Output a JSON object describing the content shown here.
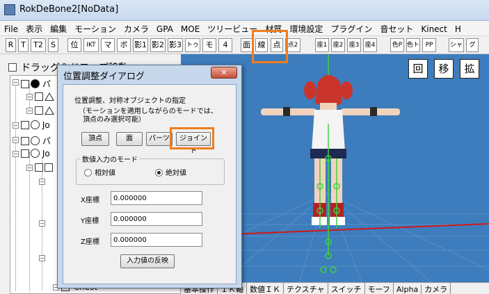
{
  "window": {
    "title": "RokDeBone2[NoData]"
  },
  "menu": [
    "File",
    "表示",
    "編集",
    "モーション",
    "カメラ",
    "GPA",
    "MOE",
    "ツリービュー",
    "材質",
    "環境設定",
    "プラグイン",
    "音セット",
    "Kinect",
    "H"
  ],
  "toolbar": {
    "mode_buttons": [
      "R",
      "T",
      "T2",
      "S",
      "位",
      "IKT",
      "マ",
      "ボ",
      "影1",
      "影2",
      "影3",
      "トゥ",
      "モ",
      "4"
    ],
    "display_buttons": [
      "面",
      "線",
      "点",
      "点2"
    ],
    "coord_buttons": [
      "座1",
      "座2",
      "座3",
      "座4"
    ],
    "color_buttons": [
      "色P",
      "色ト",
      "PP"
    ],
    "extra_buttons": [
      "シャ",
      "グ"
    ]
  },
  "left_panel": {
    "drag_label": "ドラッグ＆ドロップ移動",
    "tree_labels": [
      "パ",
      "パ",
      "Jo",
      "パ",
      "Jo",
      "Chest"
    ]
  },
  "viewport": {
    "buttons": [
      "回",
      "移",
      "拡"
    ]
  },
  "statusbar": [
    "基本操作",
    "ＩＫ軸",
    "数値ＩＫ",
    "テクスチャ",
    "スイッチ",
    "モーフ",
    "Alpha",
    "カメラ"
  ],
  "dialog": {
    "title": "位置調整ダイアログ",
    "close_label": "✕",
    "description": "位置調整、対称オブジェクトの指定",
    "note_line1": "（モーションを適用しながらのモードでは、",
    "note_line2": "頂点のみ選択可能）",
    "target_buttons": [
      "頂点",
      "面",
      "パーツ",
      "ジョイント"
    ],
    "input_mode": {
      "title": "数値入力のモード",
      "relative": "相対値",
      "absolute": "絶対値",
      "selected": "絶対値"
    },
    "fields": [
      {
        "label": "X座標",
        "value": "0.000000"
      },
      {
        "label": "Y座標",
        "value": "0.000000"
      },
      {
        "label": "Z座標",
        "value": "0.000000"
      }
    ],
    "apply_button": "入力値の反映"
  },
  "colors": {
    "viewport_bg": "#3d7dbd",
    "dialog_frame": "#c7d8ec",
    "highlight": "#f07d1e",
    "grid_red": "#d01818",
    "bone_green": "#40d040"
  }
}
